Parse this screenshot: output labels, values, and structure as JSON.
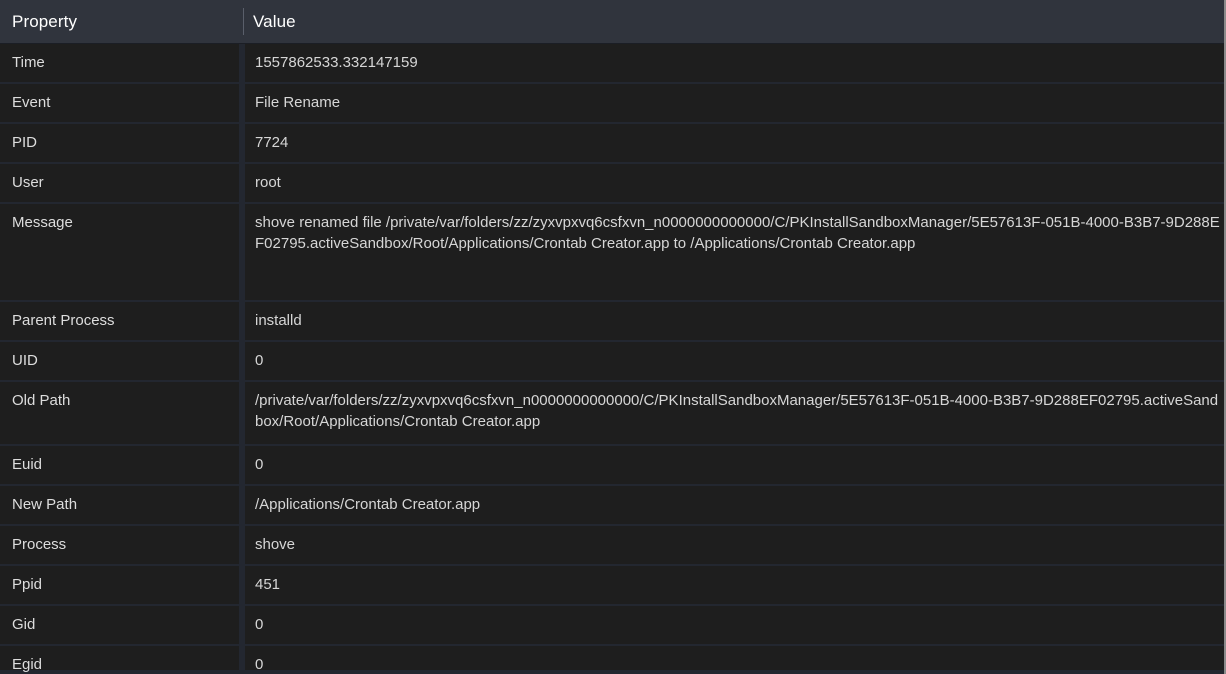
{
  "window": {
    "title": "Event Detail Property Table",
    "theme": {
      "header_bg": "#30343d",
      "row_bg": "#1e1e1e",
      "page_bg": "#232730",
      "text": "#d8d8d8",
      "header_text": "#ffffff",
      "divider": "#5a5f6b",
      "window_edge": "#8b8b8b"
    }
  },
  "table": {
    "columns": [
      {
        "key": "property",
        "label": "Property"
      },
      {
        "key": "value",
        "label": "Value"
      }
    ],
    "rows": [
      {
        "property": "Time",
        "value": "1557862533.332147159",
        "lines": 1
      },
      {
        "property": "Event",
        "value": "File Rename",
        "lines": 1
      },
      {
        "property": "PID",
        "value": "7724",
        "lines": 1
      },
      {
        "property": "User",
        "value": "root",
        "lines": 1
      },
      {
        "property": "Message",
        "value": "shove renamed file /private/var/folders/zz/zyxvpxvq6csfxvn_n0000000000000/C/PKInstallSandboxManager/5E57613F-051B-4000-B3B7-9D288EF02795.activeSandbox/Root/Applications/Crontab Creator.app to /Applications/Crontab Creator.app",
        "lines": 3
      },
      {
        "property": "Parent Process",
        "value": "installd",
        "lines": 1
      },
      {
        "property": "UID",
        "value": "0",
        "lines": 1
      },
      {
        "property": "Old Path",
        "value": "/private/var/folders/zz/zyxvpxvq6csfxvn_n0000000000000/C/PKInstallSandboxManager/5E57613F-051B-4000-B3B7-9D288EF02795.activeSandbox/Root/Applications/Crontab Creator.app",
        "lines": 2
      },
      {
        "property": "Euid",
        "value": "0",
        "lines": 1
      },
      {
        "property": "New Path",
        "value": "/Applications/Crontab Creator.app",
        "lines": 1
      },
      {
        "property": "Process",
        "value": "shove",
        "lines": 1
      },
      {
        "property": "Ppid",
        "value": "451",
        "lines": 1
      },
      {
        "property": "Gid",
        "value": "0",
        "lines": 1
      },
      {
        "property": "Egid",
        "value": "0",
        "lines": 1
      }
    ]
  }
}
